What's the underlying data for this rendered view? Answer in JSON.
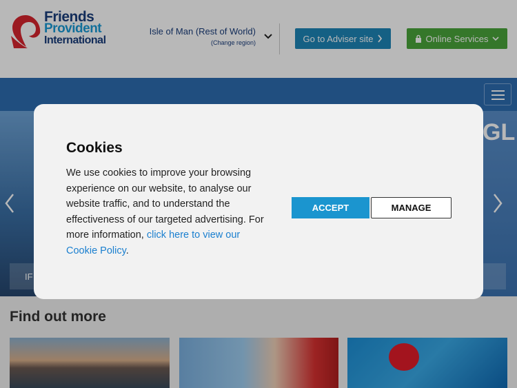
{
  "header": {
    "logo": {
      "line1": "Friends",
      "line2": "Provident",
      "line3": "International"
    },
    "region": {
      "label": "Isle of Man (Rest of World)",
      "change_link": "(Change region)"
    },
    "adviser_button": "Go to Adviser site",
    "online_services_button": "Online Services"
  },
  "hero": {
    "heading_fragment": "GL",
    "caption_fragment": "IF"
  },
  "main": {
    "section_title": "Find out more"
  },
  "cookie_modal": {
    "title": "Cookies",
    "body": "We use cookies to improve your browsing experience on our website, to analyse our website traffic, and to understand the effectiveness of our targeted advertising. For more information, ",
    "link_text": "click here to view our Cookie Policy",
    "body_end": ".",
    "accept_label": "ACCEPT",
    "manage_label": "MANAGE"
  },
  "colors": {
    "brand_navy": "#1a3d7c",
    "brand_blue": "#1a9ad6",
    "brand_red": "#d7252f",
    "adviser_blue": "#1e86b7",
    "online_green": "#4aa53b",
    "accept_blue": "#1b95cf",
    "nav_blue": "#2d6db0"
  },
  "icons": {
    "logo_icon": "rose-icon",
    "region_icon": "chevron-down-icon",
    "adviser_icon": "chevron-right-icon",
    "online_icon": "lock-icon",
    "online_chevron": "chevron-down-icon",
    "menu_icon": "hamburger-menu-icon",
    "prev_icon": "chevron-left-icon",
    "next_icon": "chevron-right-icon"
  }
}
